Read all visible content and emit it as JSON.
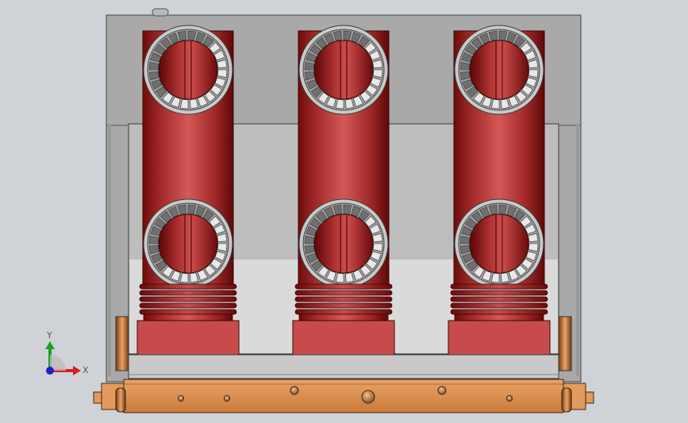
{
  "view": {
    "background": "#cfd3d8",
    "colors": {
      "frame": "#a9a9a9",
      "frame_dark": "#7f7f7f",
      "inner_panel": "#bebebe",
      "tray": "#d9d9d9",
      "pole_red": "#c74545",
      "pole_dark": "#7a1010",
      "base_copper": "#d98c4d",
      "rail": "#c8c8c8"
    }
  },
  "model": {
    "poles": [
      {
        "name": "pole-left"
      },
      {
        "name": "pole-center"
      },
      {
        "name": "pole-right"
      }
    ]
  },
  "triad": {
    "x_label": "X",
    "y_label": "Y",
    "x_color": "#d42020",
    "y_color": "#20a020",
    "z_color": "#2020c8"
  }
}
